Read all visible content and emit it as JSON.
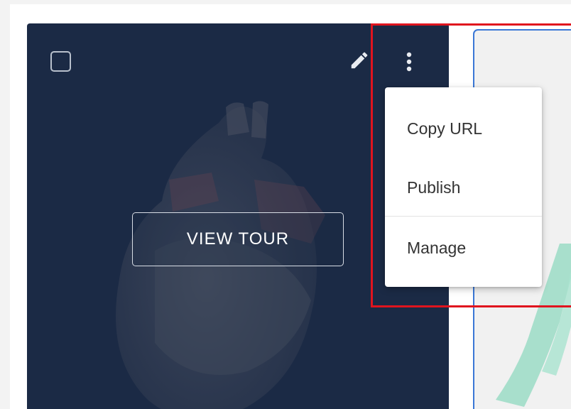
{
  "card": {
    "view_tour_label": "VIEW TOUR"
  },
  "menu": {
    "items": [
      {
        "label": "Copy URL"
      },
      {
        "label": "Publish"
      },
      {
        "label": "Manage"
      }
    ]
  },
  "icons": {
    "checkbox": "checkbox-icon",
    "edit": "pencil-icon",
    "more": "more-vertical-icon"
  },
  "colors": {
    "card_background": "#1b2a45",
    "highlight": "#e0141e",
    "selected_card_border": "#3a77d6",
    "menu_text": "#333333"
  }
}
